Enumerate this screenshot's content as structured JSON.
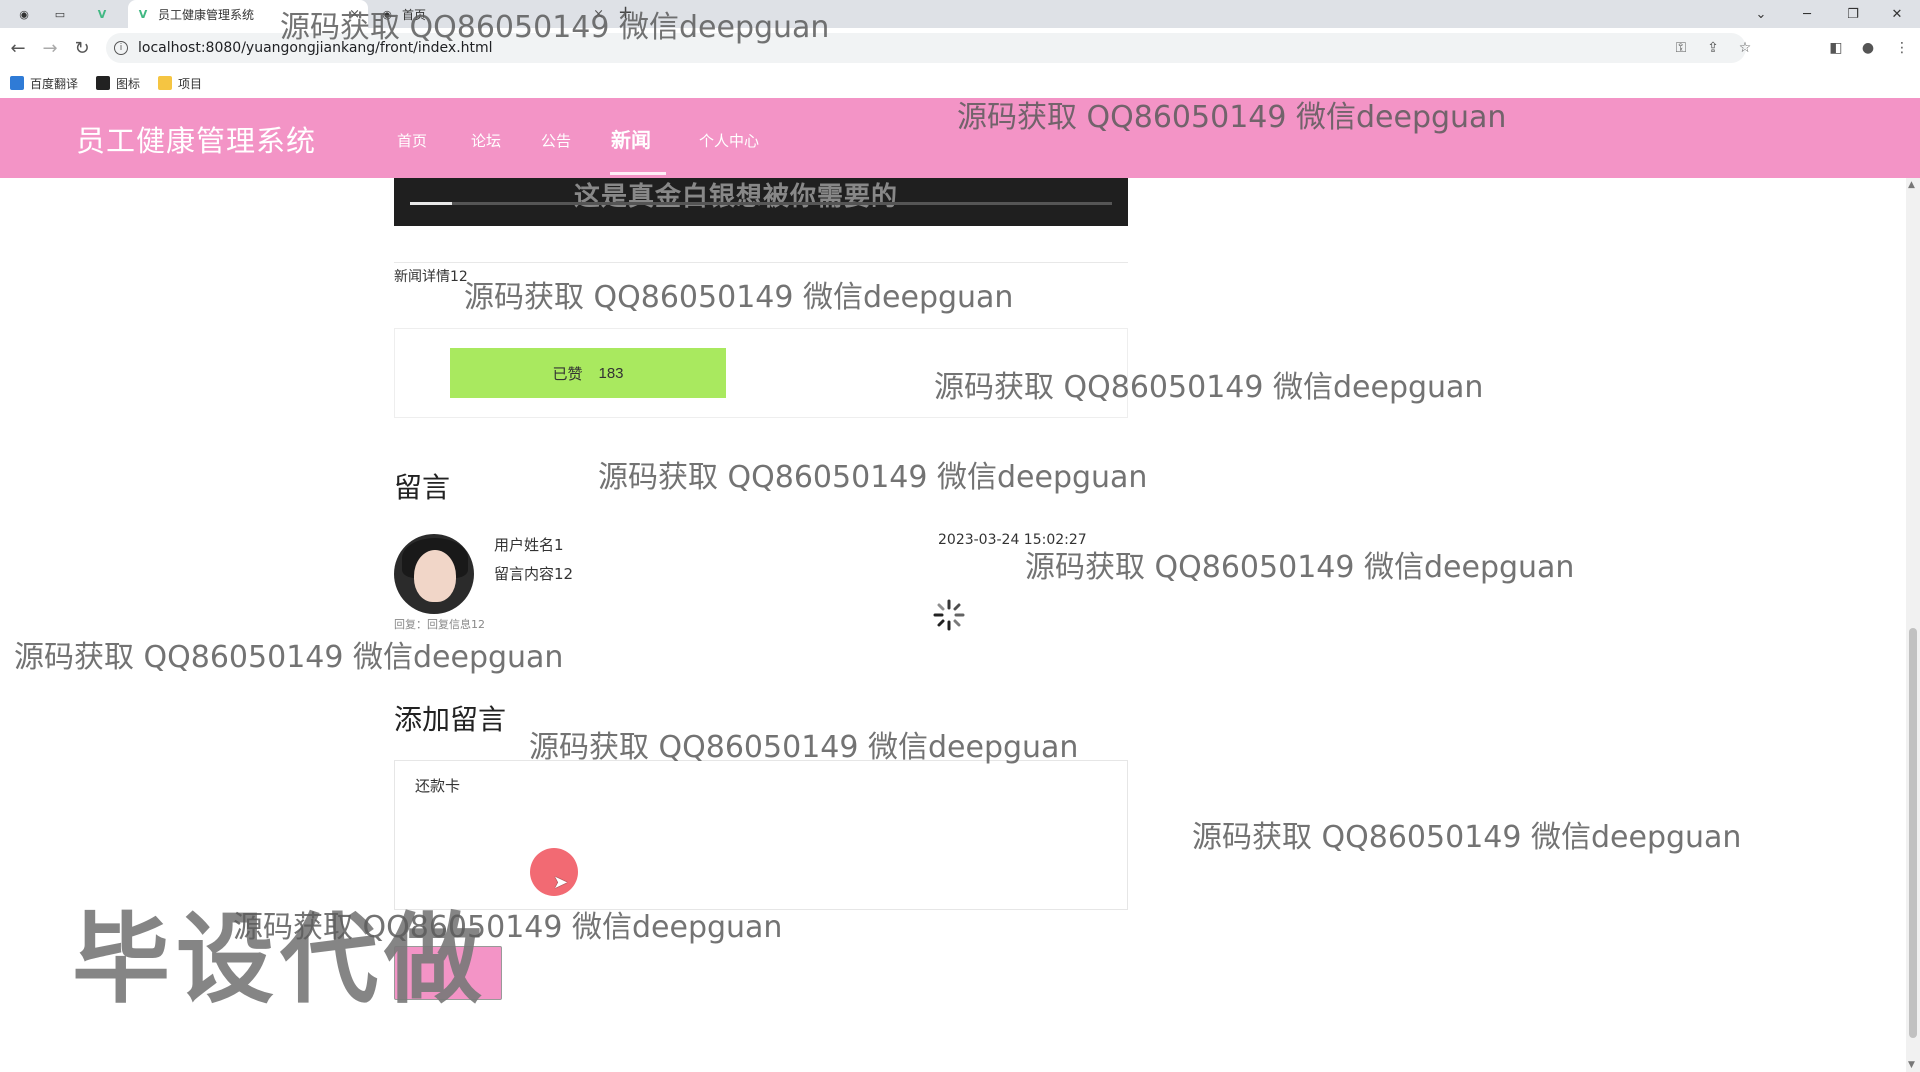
{
  "browser": {
    "tabs": [
      {
        "title": "员工健康管理系统",
        "active": true
      },
      {
        "title": "首页",
        "active": false
      }
    ],
    "close_glyph": "×",
    "new_tab_glyph": "+",
    "url": "localhost:8080/yuangongjiankang/front/index.html",
    "bookmarks": [
      "百度翻译",
      "图标",
      "项目"
    ]
  },
  "app": {
    "brand": "员工健康管理系统",
    "nav": [
      "首页",
      "论坛",
      "公告",
      "新闻",
      "个人中心"
    ],
    "active_nav": "新闻",
    "accent_color": "#f394c6"
  },
  "news": {
    "video_overlay": "这是真金白银想被你需要的",
    "detail_text": "新闻详情12",
    "like_label": "已赞",
    "like_count": "183"
  },
  "comments": {
    "heading": "留言",
    "items": [
      {
        "user": "用户姓名1",
        "content": "留言内容12",
        "time": "2023-03-24 15:02:27",
        "reply": "回复：回复信息12"
      }
    ]
  },
  "add_comment": {
    "heading": "添加留言",
    "value": "还款卡"
  },
  "overlays": {
    "watermark": "源码获取 QQ86050149 微信deepguan",
    "big_mark": "毕设代做"
  }
}
